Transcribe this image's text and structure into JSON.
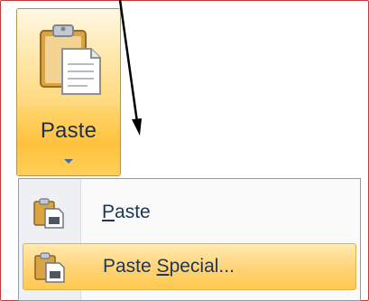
{
  "ribbon": {
    "paste_button": {
      "label": "Paste",
      "icon": "clipboard-paste-icon",
      "dropdown_icon": "chevron-down-icon"
    }
  },
  "paste_menu": {
    "items": [
      {
        "label": "Paste",
        "accelerator": "P",
        "label_rest": "aste",
        "icon": "paste-icon",
        "highlighted": false
      },
      {
        "label": "Paste Special...",
        "label_prefix": "Paste ",
        "accelerator": "S",
        "label_rest": "pecial...",
        "icon": "paste-special-icon",
        "highlighted": true
      }
    ]
  },
  "colors": {
    "highlight": "#ffd57a",
    "menu_border": "#8d9aa8",
    "text": "#203654",
    "annotation_arrow": "#000000"
  }
}
